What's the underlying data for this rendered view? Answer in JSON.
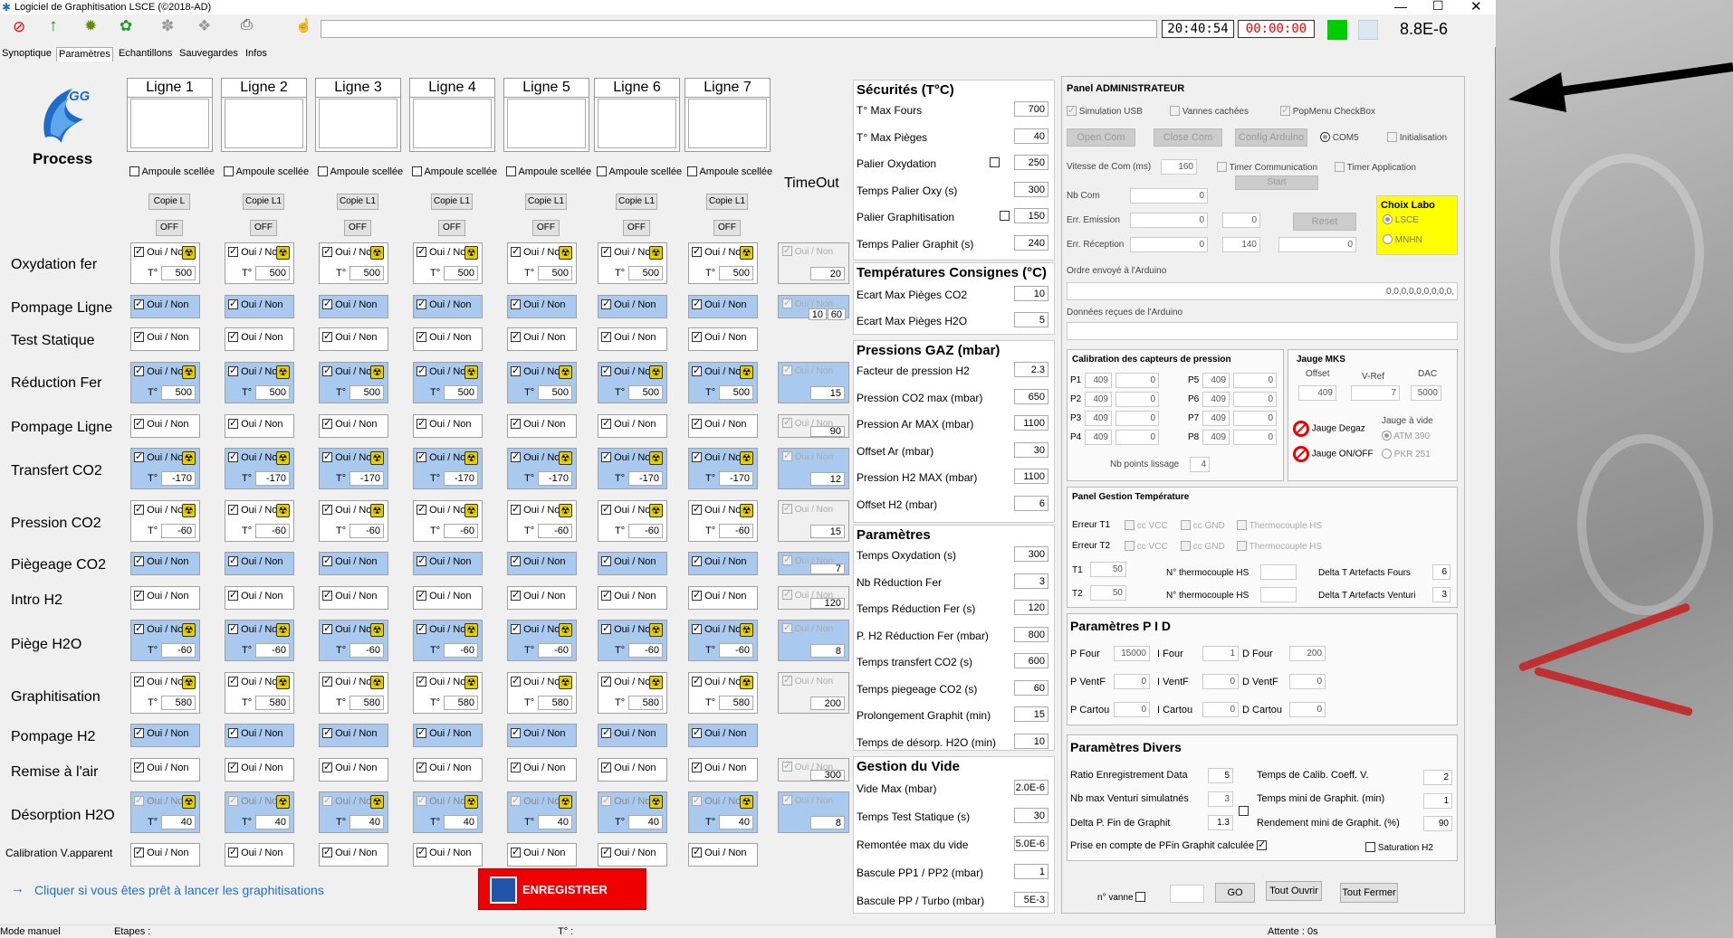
{
  "window": {
    "title": "Logiciel de Graphitisation LSCE (©2018-AD)",
    "clock": "20:40:54",
    "timer": "00:00:00",
    "pressure_readout": "8.8E-6",
    "colors": {
      "accent": "#00cc00",
      "timer_red": "#e00000",
      "blue_cell": "#a9c9ee",
      "yellow": "#ffff00"
    }
  },
  "toolbar": {
    "icons": [
      "stop-icon",
      "up-arrow-icon",
      "gear-icon",
      "green-gear-icon",
      "tool-icon",
      "tool2-icon",
      "print-icon",
      "hand-icon"
    ]
  },
  "tabs": [
    "Synoptique",
    "Paramètres",
    "Echantillons",
    "Sauvegardes",
    "Infos"
  ],
  "logo": {
    "text": "GG",
    "caption": "Process"
  },
  "lines": {
    "headers": [
      "Ligne 1",
      "Ligne 2",
      "Ligne 3",
      "Ligne 4",
      "Ligne 5",
      "Ligne 6",
      "Ligne 7"
    ],
    "ampoule_label": "Ampoule scellée",
    "copie_labels": [
      "Copie L",
      "Copie L1",
      "Copie L1",
      "Copie L1",
      "Copie L1",
      "Copie L1",
      "Copie L1"
    ],
    "off_label": "OFF",
    "ouinon": "Oui / Non",
    "t_label": "T°",
    "timeout_header": "TimeOut"
  },
  "steps": [
    {
      "label": "Oxydation fer",
      "type": "temp",
      "style": "white",
      "value": "500",
      "timeout": "20"
    },
    {
      "label": "Pompage Ligne",
      "type": "simple",
      "style": "blue",
      "timeout2": [
        "10",
        "60"
      ]
    },
    {
      "label": "Test Statique",
      "type": "simple",
      "style": "white"
    },
    {
      "label": "Réduction Fer",
      "type": "temp",
      "style": "blue",
      "value": "500",
      "timeout": "15"
    },
    {
      "label": "Pompage Ligne",
      "type": "simple",
      "style": "white",
      "timeout": "90"
    },
    {
      "label": "Transfert CO2",
      "type": "temp",
      "style": "blue",
      "value": "-170",
      "timeout": "12"
    },
    {
      "label": "Pression CO2",
      "type": "temp",
      "style": "white",
      "value": "-60",
      "timeout": "15"
    },
    {
      "label": "Piègeage CO2",
      "type": "simple",
      "style": "blue",
      "timeout": "7"
    },
    {
      "label": "Intro H2",
      "type": "simple",
      "style": "white",
      "timeout": "120"
    },
    {
      "label": "Piège H2O",
      "type": "temp",
      "style": "blue",
      "value": "-60",
      "timeout": "8"
    },
    {
      "label": "Graphitisation",
      "type": "temp",
      "style": "white",
      "value": "580",
      "timeout": "200"
    },
    {
      "label": "Pompage H2",
      "type": "simple",
      "style": "blue"
    },
    {
      "label": "Remise à l'air",
      "type": "simple",
      "style": "white",
      "timeout": "300"
    },
    {
      "label": "Désorption H2O",
      "type": "temp",
      "style": "blue",
      "value": "40",
      "timeout": "8"
    },
    {
      "label": "Calibration V.apparent",
      "type": "simple",
      "style": "white"
    }
  ],
  "footer": {
    "hint": "Cliquer si vous êtes prêt à lancer les graphitisations",
    "save_button": "ENREGISTRER",
    "status_mode": "Mode manuel",
    "status_etapes": "Etapes :",
    "status_t": "T° :",
    "status_attente": "Attente : 0s"
  },
  "params": {
    "securites": {
      "title": "Sécurités (T°C)",
      "items": [
        {
          "label": "T° Max Fours",
          "value": "700"
        },
        {
          "label": "T° Max Pièges",
          "value": "40"
        },
        {
          "label": "Palier Oxydation",
          "value": "250"
        },
        {
          "label": "Temps Palier Oxy (s)",
          "value": "300"
        },
        {
          "label": "Palier Graphitisation",
          "value": "150"
        },
        {
          "label": "Temps Palier Graphit (s)",
          "value": "240"
        }
      ]
    },
    "temperatures": {
      "title": "Températures Consignes (°C)",
      "items": [
        {
          "label": "Ecart Max Pièges CO2",
          "value": "10"
        },
        {
          "label": "Ecart Max Pièges H2O",
          "value": "5"
        }
      ]
    },
    "pressions": {
      "title": "Pressions GAZ (mbar)",
      "items": [
        {
          "label": "Facteur de pression H2",
          "value": "2.3"
        },
        {
          "label": "Pression CO2 max (mbar)",
          "value": "650"
        },
        {
          "label": "Pression Ar MAX (mbar)",
          "value": "1100"
        },
        {
          "label": "Offset Ar (mbar)",
          "value": "30"
        },
        {
          "label": "Pression H2 MAX (mbar)",
          "value": "1100"
        },
        {
          "label": "Offset H2 (mbar)",
          "value": "6"
        }
      ]
    },
    "parametres": {
      "title": "Paramètres",
      "items": [
        {
          "label": "Temps Oxydation (s)",
          "value": "300"
        },
        {
          "label": "Nb Réduction Fer",
          "value": "3"
        },
        {
          "label": "Temps Réduction Fer (s)",
          "value": "120"
        },
        {
          "label": "P. H2 Réduction Fer (mbar)",
          "value": "800"
        },
        {
          "label": "Temps transfert CO2 (s)",
          "value": "600"
        },
        {
          "label": "Temps piegeage CO2 (s)",
          "value": "60"
        },
        {
          "label": "Prolongement Graphit (min)",
          "value": "15"
        },
        {
          "label": "Temps de désorp. H2O (min)",
          "value": "10"
        }
      ]
    },
    "vide": {
      "title": "Gestion du Vide",
      "items": [
        {
          "label": "Vide Max (mbar)",
          "value": "2.0E-6"
        },
        {
          "label": "Temps Test Statique (s)",
          "value": "30"
        },
        {
          "label": "Remontée max du vide",
          "value": "5.0E-6"
        },
        {
          "label": "Bascule PP1 / PP2 (mbar)",
          "value": "1"
        },
        {
          "label": "Bascule PP / Turbo (mbar)",
          "value": "5E-3"
        }
      ]
    }
  },
  "admin": {
    "title": "Panel ADMINISTRATEUR",
    "simulation_usb": "Simulation USB",
    "vannes_cachees": "Vannes cachées",
    "popmenu": "PopMenu CheckBox",
    "open_com": "Open Com",
    "close_com": "Close Com",
    "config_arduino": "Config Arduino",
    "com": "COM5",
    "initialisation": "Initialisation",
    "vitesse_label": "Vitesse de Com (ms)",
    "vitesse": "160",
    "timer_comm": "Timer Communication",
    "timer_app": "Timer Application",
    "start": "Start",
    "nbcom_label": "Nb Com",
    "nbcom": "0",
    "err_emission_label": "Err. Emission",
    "err_emission": [
      "0",
      "0"
    ],
    "reset": "Reset",
    "err_reception_label": "Err. Réception",
    "err_reception": [
      "0",
      "140",
      "0"
    ],
    "choix_labo": "Choix Labo",
    "labos": [
      "LSCE",
      "MNHN"
    ],
    "ordre_label": "Ordre envoyé à l'Arduino",
    "ordre_value": "0,0,0,0,0,0,0,0,0,",
    "donnees_label": "Données reçues de l'Arduino"
  },
  "calibration": {
    "title": "Calibration des capteurs de pression",
    "left": [
      {
        "label": "P1",
        "a": "409",
        "b": "0"
      },
      {
        "label": "P2",
        "a": "409",
        "b": "0"
      },
      {
        "label": "P3",
        "a": "409",
        "b": "0"
      },
      {
        "label": "P4",
        "a": "409",
        "b": "0"
      }
    ],
    "right": [
      {
        "label": "P5",
        "a": "409",
        "b": "0"
      },
      {
        "label": "P6",
        "a": "409",
        "b": "0"
      },
      {
        "label": "P7",
        "a": "409",
        "b": "0"
      },
      {
        "label": "P8",
        "a": "409",
        "b": "0"
      }
    ],
    "nb_points_label": "Nb points lissage",
    "nb_points": "4"
  },
  "mks": {
    "title": "Jauge MKS",
    "offset_label": "Offset",
    "vref_label": "V-Ref",
    "dac_label": "DAC",
    "offset": "409",
    "vref": "7",
    "dac": "5000",
    "degaz": "Jauge Degaz",
    "onoff": "Jauge ON/OFF",
    "vide_label": "Jauge à vide",
    "atm": "ATM 390",
    "pkr": "PKR 251"
  },
  "temp_panel": {
    "title": "Panel Gestion Température",
    "erreur_t1": "Erreur T1",
    "erreur_t2": "Erreur T2",
    "ccvcc": "cc VCC",
    "ccgnd": "cc GND",
    "thermo_hs": "Thermocouple HS",
    "t1_label": "T1",
    "t1": "50",
    "t2_label": "T2",
    "t2": "50",
    "no_thermo": "N° thermocouple HS",
    "delta_fours_label": "Delta T Artefacts Fours",
    "delta_fours": "6",
    "delta_venturi_label": "Delta T Artefacts Venturi",
    "delta_venturi": "3"
  },
  "pid": {
    "title": "Paramètres P I D",
    "rows": [
      {
        "p_label": "P Four",
        "p": "15000",
        "i_label": "I Four",
        "i": "1",
        "d_label": "D Four",
        "d": "200"
      },
      {
        "p_label": "P VentF",
        "p": "0",
        "i_label": "I VentF",
        "i": "0",
        "d_label": "D VentF",
        "d": "0"
      },
      {
        "p_label": "P Cartou",
        "p": "0",
        "i_label": "I Cartou",
        "i": "0",
        "d_label": "D Cartou",
        "d": "0"
      }
    ]
  },
  "divers": {
    "title": "Paramètres Divers",
    "ratio_label": "Ratio Enregistrement Data",
    "ratio": "5",
    "calib_label": "Temps de Calib. Coeff. V.",
    "calib": "2",
    "venturi_label": "Nb max Venturi simulatnés",
    "venturi": "3",
    "tmini_label": "Temps mini de Graphit. (min)",
    "tmini": "1",
    "deltap_label": "Delta P. Fin de Graphit",
    "deltap": "1.3",
    "rend_label": "Rendement mini de Graphit. (%)",
    "rend": "90",
    "pfin_label": "Prise en compte de PFin Graphit calculée",
    "saturation_label": "Saturation H2"
  },
  "bottom_controls": {
    "vanne_label": "n° vanne",
    "go": "GO",
    "tout_ouvrir": "Tout Ouvrir",
    "tout_fermer": "Tout Fermer"
  }
}
